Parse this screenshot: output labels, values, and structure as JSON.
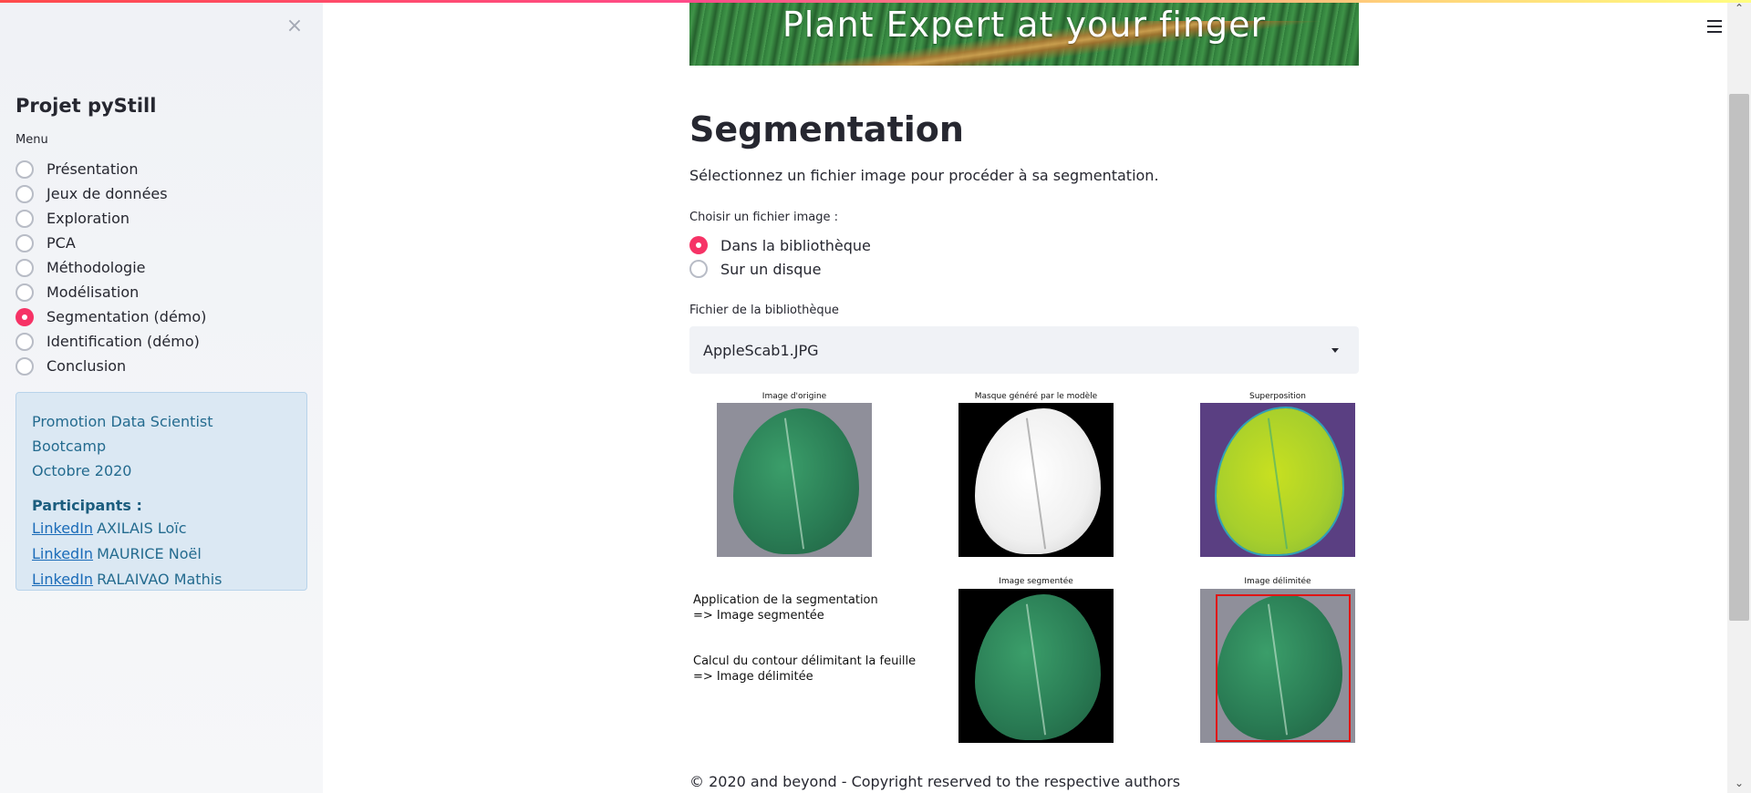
{
  "sidebar": {
    "close_glyph": "×",
    "title": "Projet pyStill",
    "menu_label": "Menu",
    "items": [
      {
        "label": "Présentation",
        "selected": false
      },
      {
        "label": "Jeux de données",
        "selected": false
      },
      {
        "label": "Exploration",
        "selected": false
      },
      {
        "label": "PCA",
        "selected": false
      },
      {
        "label": "Méthodologie",
        "selected": false
      },
      {
        "label": "Modélisation",
        "selected": false
      },
      {
        "label": "Segmentation (démo)",
        "selected": true
      },
      {
        "label": "Identification (démo)",
        "selected": false
      },
      {
        "label": "Conclusion",
        "selected": false
      }
    ],
    "info": {
      "line1": "Promotion Data Scientist Bootcamp",
      "line2": "Octobre 2020",
      "participants_label": "Participants :",
      "members": [
        {
          "link": "LinkedIn",
          "name": "AXILAIS Loïc"
        },
        {
          "link": "LinkedIn",
          "name": "MAURICE Noël"
        },
        {
          "link": "LinkedIn",
          "name": "RALAIVAO Mathis"
        }
      ]
    }
  },
  "main": {
    "banner_text": "Plant Expert at your finger",
    "title": "Segmentation",
    "intro": "Sélectionnez un fichier image pour procéder à sa segmentation.",
    "choose_label": "Choisir un fichier image :",
    "source_options": [
      {
        "label": "Dans la bibliothèque",
        "selected": true
      },
      {
        "label": "Sur un disque",
        "selected": false
      }
    ],
    "library_label": "Fichier de la bibliothèque",
    "selected_file": "AppleScab1.JPG",
    "figures": {
      "original": "Image d'origine",
      "mask": "Masque généré par le modèle",
      "overlay": "Superposition",
      "segmented": "Image segmentée",
      "delimited": "Image délimitée"
    },
    "desc1_line1": "Application de la segmentation",
    "desc1_line2": "=> Image segmentée",
    "desc2_line1": "Calcul du contour délimitant la feuille",
    "desc2_line2": "=> Image délimitée",
    "footer": "© 2020 and beyond - Copyright reserved to the respective authors"
  },
  "colors": {
    "accent": "#f63366",
    "sidebar_bg": "#f0f2f6",
    "info_bg": "#dbe8f3"
  }
}
